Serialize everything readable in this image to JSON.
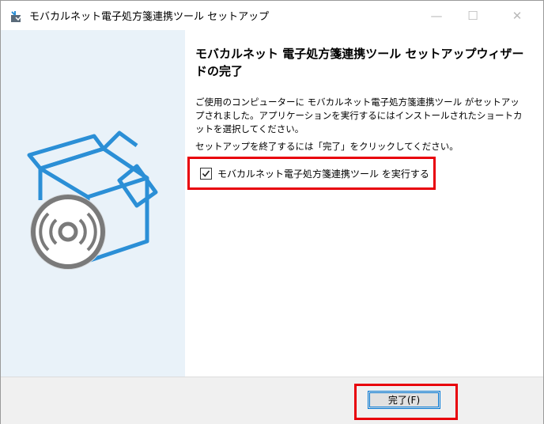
{
  "window": {
    "title": "モバカルネット電子処方箋連携ツール セットアップ",
    "minimize_glyph": "—",
    "maximize_glyph": "☐",
    "close_glyph": "✕"
  },
  "wizard": {
    "heading": "モバカルネット 電子処方箋連携ツール セットアップウィザードの完了",
    "paragraph1": "ご使用のコンピューターに モバカルネット電子処方箋連携ツール がセットアップされました。アプリケーションを実行するにはインストールされたショートカットを選択してください。",
    "paragraph2": "セットアップを終了するには「完了」をクリックしてください。",
    "run_checkbox": {
      "label": "モバカルネット電子処方箋連携ツール を実行する",
      "checked": true
    }
  },
  "footer": {
    "finish_label": "完了(F)"
  },
  "icons": {
    "app": "installer-icon",
    "illustration": "box-with-disc-icon",
    "check": "checkmark-icon"
  },
  "colors": {
    "left_panel_bg": "#e9f2f9",
    "box_blue": "#2b8fd6",
    "highlight_red": "#e8000b",
    "accent": "#0078d7"
  }
}
